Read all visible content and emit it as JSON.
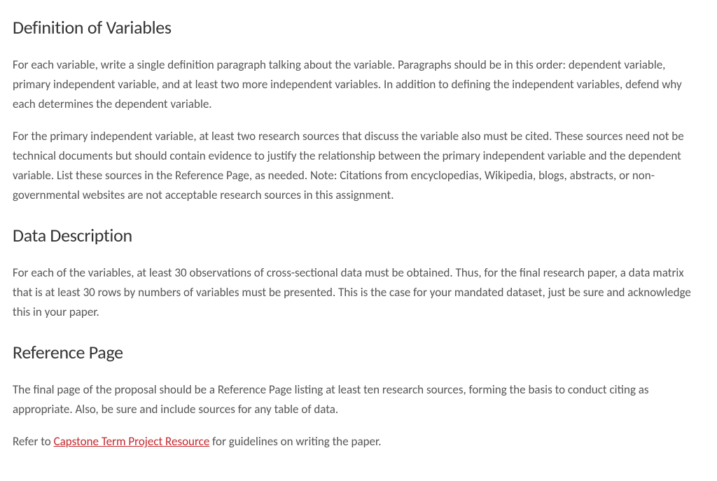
{
  "sections": {
    "definition": {
      "heading": "Definition of Variables",
      "para1": "For each variable, write a single definition paragraph talking about the variable. Paragraphs should be in this order: dependent variable, primary independent variable, and at least two more independent variables.  In addition to defining the independent variables, defend why each determines the dependent variable.",
      "para2": "For the primary independent variable, at least two research sources that discuss the variable also must be cited.  These sources need not be technical documents but should contain evidence to justify the relationship between the primary independent variable and the dependent variable.  List these sources in the Reference Page, as needed.  Note: Citations from encyclopedias, Wikipedia, blogs, abstracts, or non-governmental websites are not acceptable research sources in this assignment."
    },
    "datadesc": {
      "heading": "Data Description",
      "para1": "For each of the variables, at least 30 observations of cross-sectional data must be obtained.  Thus, for the final research paper, a data matrix that is at least 30 rows by numbers of variables must be presented.  This is the case for your mandated dataset, just be sure and acknowledge this in your paper."
    },
    "reference": {
      "heading": "Reference Page",
      "para1": "The final page of the proposal should be a Reference Page listing at least ten research sources, forming the basis to conduct citing as appropriate.  Also, be sure and include sources for any table of data.",
      "refer_prefix": "Refer to ",
      "link_text": "Capstone Term Project Resource",
      "refer_suffix": " for guidelines on writing the paper."
    }
  }
}
